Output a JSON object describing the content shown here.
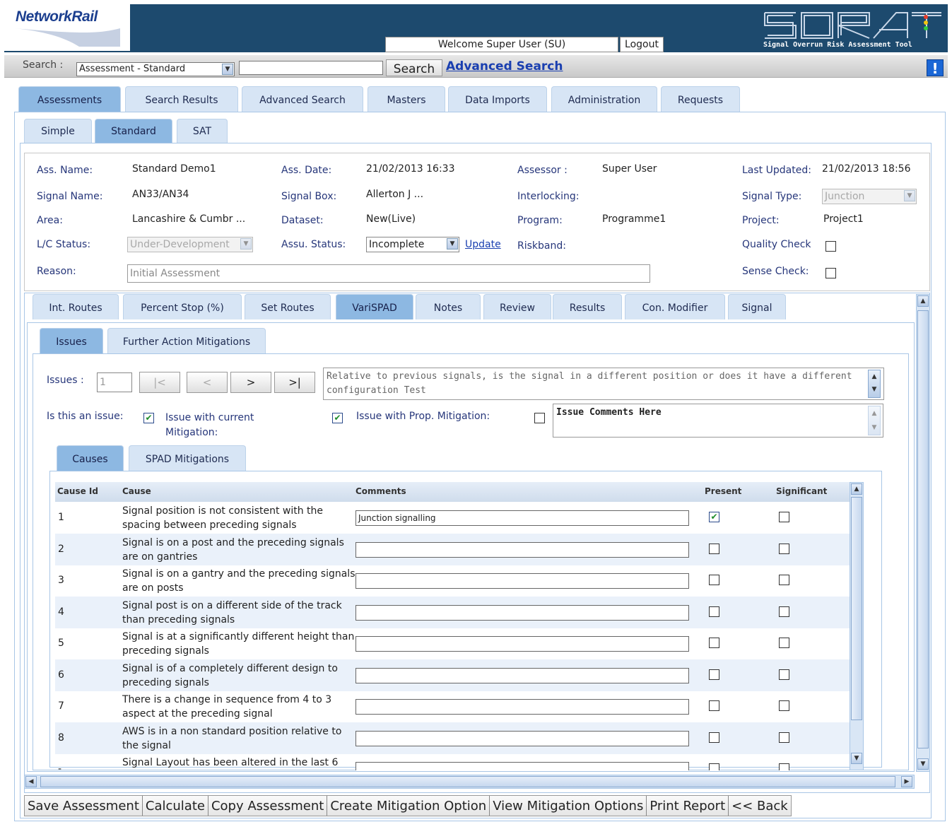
{
  "header": {
    "logo_text": "NetworkRail",
    "welcome": "Welcome Super User (SU)",
    "logout": "Logout",
    "product_logo": "SORAT",
    "product_name": "Signal Overrun Risk Assessment Tool"
  },
  "search": {
    "label": "Search :",
    "select_value": "Assessment - Standard",
    "input_value": "",
    "button": "Search",
    "advanced_link": "Advanced Search",
    "help_icon": "!"
  },
  "main_tabs": [
    "Assessments",
    "Search Results",
    "Advanced Search",
    "Masters",
    "Data Imports",
    "Administration",
    "Requests"
  ],
  "sub_tabs": [
    "Simple",
    "Standard",
    "SAT"
  ],
  "assessment": {
    "name_label": "Ass. Name:",
    "name": "Standard Demo1",
    "date_label": "Ass. Date:",
    "date": "21/02/2013 16:33",
    "assessor_label": "Assessor :",
    "assessor": "Super User",
    "last_updated_label": "Last Updated:",
    "last_updated": "21/02/2013 18:56",
    "signal_name_label": "Signal Name:",
    "signal_name": "AN33/AN34",
    "signal_box_label": "Signal Box:",
    "signal_box": "Allerton J ...",
    "interlocking_label": "Interlocking:",
    "signal_type_label": "Signal Type:",
    "signal_type": "Junction",
    "area_label": "Area:",
    "area": "Lancashire & Cumbr ...",
    "dataset_label": "Dataset:",
    "dataset": "New(Live)",
    "program_label": "Program:",
    "program": "Programme1",
    "project_label": "Project:",
    "project": "Project1",
    "lc_status_label": "L/C Status:",
    "lc_status": "Under-Development",
    "assu_status_label": "Assu. Status:",
    "assu_status": "Incomplete",
    "update_link": "Update",
    "riskband_label": "Riskband:",
    "quality_check_label": "Quality Check",
    "reason_label": "Reason:",
    "reason": "Initial Assessment",
    "sense_check_label": "Sense Check:"
  },
  "section_tabs": [
    "Int. Routes",
    "Percent Stop (%)",
    "Set Routes",
    "VariSPAD",
    "Notes",
    "Review",
    "Results",
    "Con. Modifier",
    "Signal"
  ],
  "issue_tabs": [
    "Issues",
    "Further Action Mitigations"
  ],
  "issues": {
    "label": "Issues :",
    "number": "1",
    "nav": [
      "|<",
      "<",
      ">",
      ">|"
    ],
    "question": "Relative to previous signals, is the signal in a different position or does it have a different configuration Test",
    "is_issue_label": "Is this an issue:",
    "current_mitigation_label": "Issue with current Mitigation:",
    "prop_mitigation_label": "Issue with Prop. Mitigation:",
    "comments": "Issue Comments Here"
  },
  "cause_tabs": [
    "Causes",
    "SPAD Mitigations"
  ],
  "grid": {
    "columns": [
      "Cause Id",
      "Cause",
      "Comments",
      "Present",
      "Significant"
    ],
    "rows": [
      {
        "id": "1",
        "cause": "Signal position is not consistent with the spacing between preceding signals",
        "comment": "Junction signalling",
        "present": true,
        "significant": false
      },
      {
        "id": "2",
        "cause": "Signal is on a post and the preceding signals are on gantries",
        "comment": "",
        "present": false,
        "significant": false
      },
      {
        "id": "3",
        "cause": "Signal is on a gantry and the preceding signals are on posts",
        "comment": "",
        "present": false,
        "significant": false
      },
      {
        "id": "4",
        "cause": "Signal post is on a different side of the track than preceding signals",
        "comment": "",
        "present": false,
        "significant": false
      },
      {
        "id": "5",
        "cause": "Signal is at a significantly different height than preceding signals",
        "comment": "",
        "present": false,
        "significant": false
      },
      {
        "id": "6",
        "cause": "Signal is of a completely different design to preceding signals",
        "comment": "",
        "present": false,
        "significant": false
      },
      {
        "id": "7",
        "cause": "There is a change in sequence from 4 to 3 aspect at the preceding signal",
        "comment": "",
        "present": false,
        "significant": false
      },
      {
        "id": "8",
        "cause": "AWS is in a non standard position relative to the signal",
        "comment": "",
        "present": false,
        "significant": false
      },
      {
        "id": "-",
        "cause": "Signal Layout has been altered in the last 6",
        "comment": "",
        "present": false,
        "significant": false
      }
    ]
  },
  "bottom_buttons": [
    "Save Assessment",
    "Calculate",
    "Copy Assessment",
    "Create Mitigation Option",
    "View Mitigation Options",
    "Print Report",
    "<< Back"
  ]
}
